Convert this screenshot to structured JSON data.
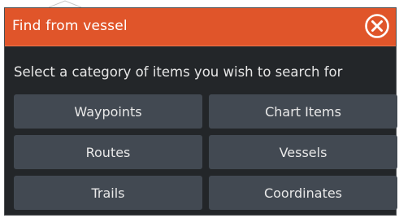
{
  "dialog": {
    "title": "Find from vessel",
    "close_icon": "close-circle-icon",
    "prompt": "Select a category of items you wish to search for",
    "accent_color": "#e0552a",
    "background_color": "#232629",
    "button_color": "#424952",
    "buttons": [
      {
        "label": "Waypoints"
      },
      {
        "label": "Chart Items"
      },
      {
        "label": "Routes"
      },
      {
        "label": "Vessels"
      },
      {
        "label": "Trails"
      },
      {
        "label": "Coordinates"
      }
    ]
  }
}
